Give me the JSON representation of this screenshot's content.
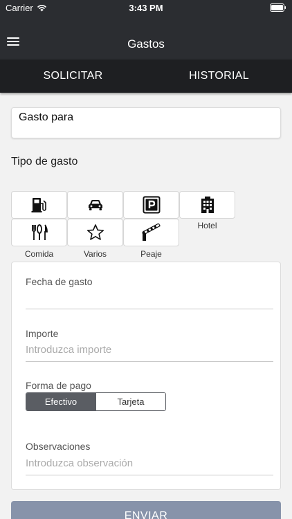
{
  "status_bar": {
    "carrier": "Carrier",
    "time": "3:43 PM"
  },
  "navbar": {
    "title": "Gastos"
  },
  "tabs": [
    {
      "label": "SOLICITAR"
    },
    {
      "label": "HISTORIAL"
    }
  ],
  "gasto_para": {
    "value": "Gasto para"
  },
  "tipo_gasto": {
    "heading": "Tipo de gasto",
    "types": [
      {
        "icon": "fuel-icon",
        "label": ""
      },
      {
        "icon": "car-icon",
        "label": ""
      },
      {
        "icon": "parking-icon",
        "label": ""
      },
      {
        "icon": "hotel-icon",
        "label": "Hotel"
      },
      {
        "icon": "cutlery-icon",
        "label": "Comida"
      },
      {
        "icon": "star-icon",
        "label": "Varios"
      },
      {
        "icon": "toll-barrier-icon",
        "label": "Peaje"
      }
    ]
  },
  "form": {
    "fecha": {
      "label": "Fecha de gasto",
      "value": ""
    },
    "importe": {
      "label": "Importe",
      "placeholder": "Introduzca importe"
    },
    "forma_pago": {
      "label": "Forma de pago",
      "options": [
        "Efectivo",
        "Tarjeta"
      ],
      "selected": "Efectivo"
    },
    "observaciones": {
      "label": "Observaciones",
      "placeholder": "Introduzca observación"
    }
  },
  "submit": {
    "label": "ENVIAR"
  },
  "colors": {
    "header": "#2b2d31",
    "tabs": "#1e1f22",
    "segment_active": "#5a5d63",
    "submit": "#8793aa"
  }
}
